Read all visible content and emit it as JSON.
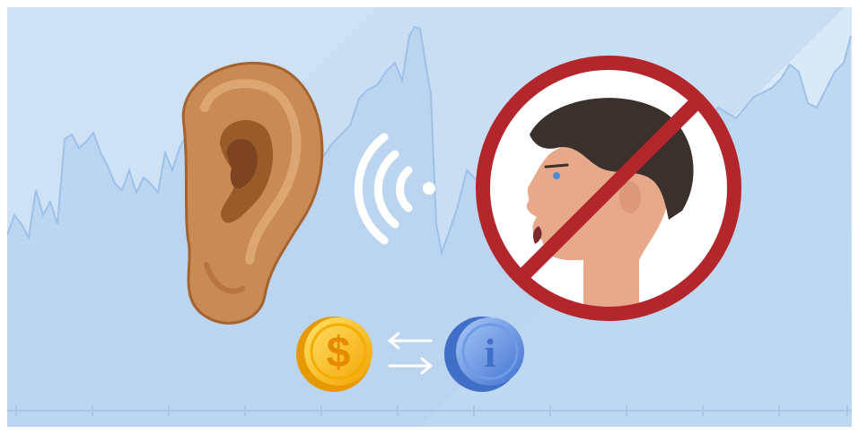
{
  "illustration": {
    "background_color": "#cfe2f5",
    "stripe_color": "#dceaf8",
    "chart_line_color": "#9dc1e8",
    "chart_fill_color": "#b6d2ef",
    "axis_color": "#a9c6e8",
    "ear_color": "#c98a54",
    "signal_color": "#ffffff",
    "prohibition_color": "#b3272c",
    "coin_gold_color": "#f5b800",
    "coin_blue_color": "#5b8ee0",
    "dollar_symbol": "$",
    "info_symbol": "i",
    "icons": [
      "ear-icon",
      "sound-waves-icon",
      "no-talking-icon",
      "dollar-coin-icon",
      "info-coin-icon",
      "exchange-arrows-icon"
    ]
  }
}
